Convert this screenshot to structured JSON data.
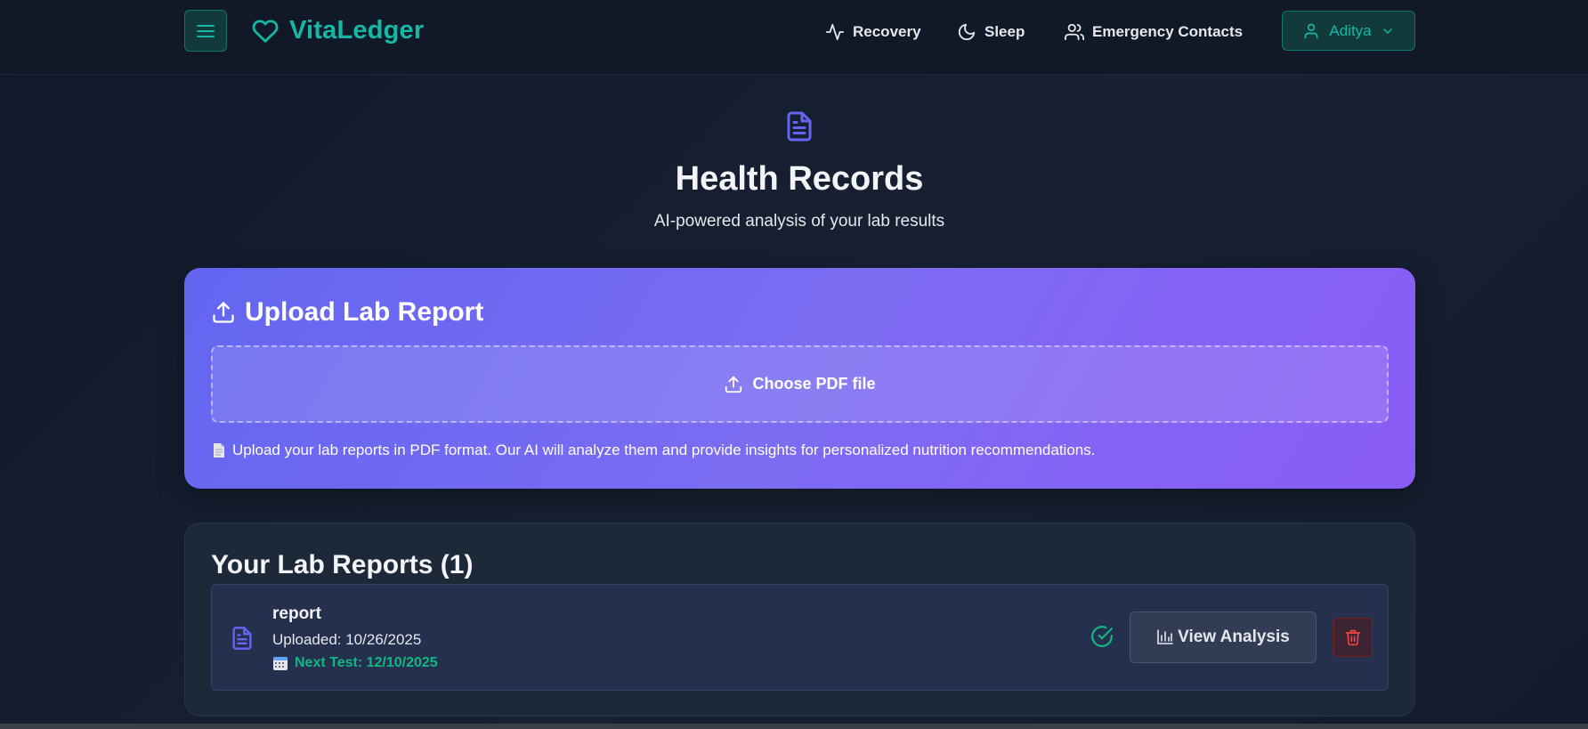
{
  "app": {
    "name": "VitaLedger",
    "colors": {
      "accent": "#14b8a6",
      "primary": "#6366f1",
      "purple": "#8b5cf6",
      "success": "#10b981",
      "danger": "#ef4444",
      "background": "#111827"
    }
  },
  "header": {
    "nav": [
      {
        "label": "Recovery",
        "icon": "activity-icon"
      },
      {
        "label": "Sleep",
        "icon": "moon-icon"
      },
      {
        "label": "Emergency Contacts",
        "icon": "users-icon"
      }
    ],
    "user": {
      "name": "Aditya",
      "icon": "user-icon"
    }
  },
  "hero": {
    "title": "Health Records",
    "subtitle": "AI-powered analysis of your lab results",
    "icon": "document-icon"
  },
  "upload": {
    "title": "Upload Lab Report",
    "choose_label": "Choose PDF file",
    "note": "Upload your lab reports in PDF format. Our AI will analyze them and provide insights for personalized nutrition recommendations."
  },
  "reports": {
    "title": "Your Lab Reports (1)",
    "items": [
      {
        "name": "report",
        "uploaded": "Uploaded: 10/26/2025",
        "next_test": "Next Test: 12/10/2025",
        "view_label": "View Analysis"
      }
    ]
  }
}
